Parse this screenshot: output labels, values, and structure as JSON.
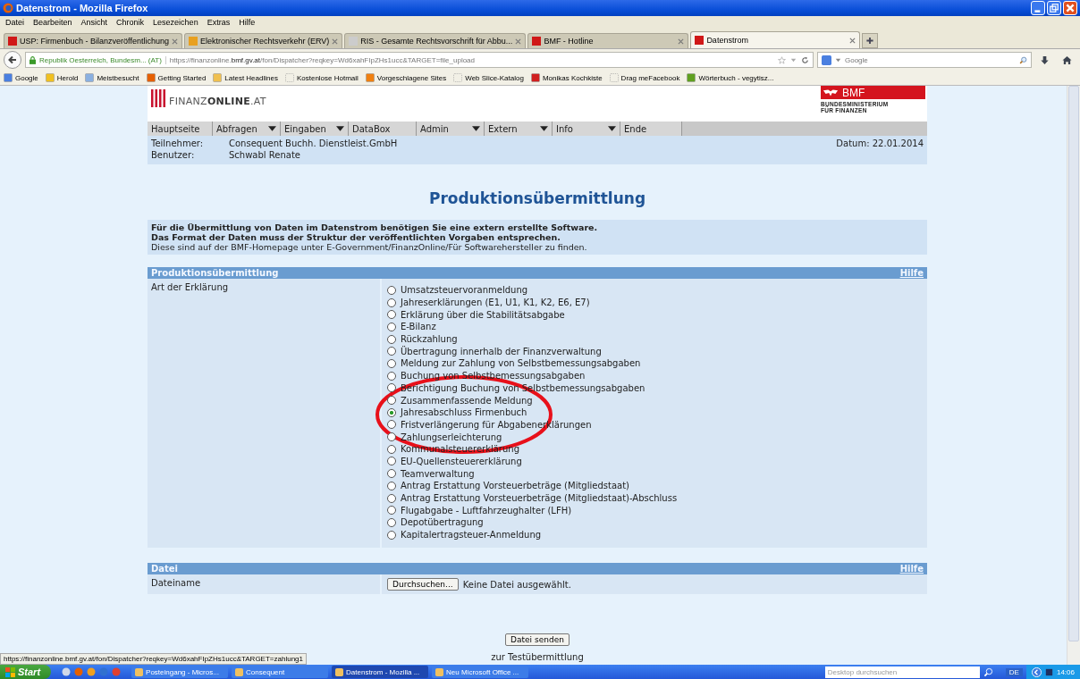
{
  "window": {
    "title": "Datenstrom - Mozilla Firefox"
  },
  "menu": [
    "Datei",
    "Bearbeiten",
    "Ansicht",
    "Chronik",
    "Lesezeichen",
    "Extras",
    "Hilfe"
  ],
  "tabs": [
    {
      "label": "USP: Firmenbuch - Bilanzveröffentlichung",
      "selected": false
    },
    {
      "label": "Elektronischer Rechtsverkehr (ERV)",
      "selected": false
    },
    {
      "label": "RIS - Gesamte Rechtsvorschrift für Abbu...",
      "selected": false
    },
    {
      "label": "BMF - Hotline",
      "selected": false
    },
    {
      "label": "Datenstrom",
      "selected": true
    }
  ],
  "address": {
    "identity": "Republik Oesterreich, Bundesm... (AT)",
    "url": "https://finanzonline.**bmf.gv.at**/fon/Dispatcher?reqkey=Wd6xahFIpZHs1ucc&TARGET=file_upload"
  },
  "search": {
    "placeholder": "Google"
  },
  "bookmarks": [
    "Google",
    "Herold",
    "Meistbesucht",
    "Getting Started",
    "Latest Headlines",
    "Kostenlose Hotmail",
    "Vorgeschlagene Sites",
    "Web Slice-Katalog",
    "Monikas Kochkiste",
    "Drag meFacebook",
    "Wörterbuch - vegytisz..."
  ],
  "page": {
    "logo": "FINANZ**ONLINE**.AT",
    "ministry": {
      "name": "BMF",
      "line1": "BUNDESMINISTERIUM",
      "line2": "FÜR FINANZEN"
    },
    "nav": [
      {
        "label": "Hauptseite",
        "dropdown": false
      },
      {
        "label": "Abfragen",
        "dropdown": true
      },
      {
        "label": "Eingaben",
        "dropdown": true
      },
      {
        "label": "DataBox",
        "dropdown": false
      },
      {
        "label": "Admin",
        "dropdown": true
      },
      {
        "label": "Extern",
        "dropdown": true
      },
      {
        "label": "Info",
        "dropdown": true
      },
      {
        "label": "Ende",
        "dropdown": false
      }
    ],
    "info": [
      {
        "label": "Teilnehmer:",
        "value": "Consequent Buchh. Dienstleist.GmbH"
      },
      {
        "label": "Benutzer:",
        "value": "Schwabl Renate"
      }
    ],
    "date": "Datum: 22.01.2014",
    "heading": "Produktionsübermittlung",
    "intro_bold": [
      "Für die Übermittlung von Daten im Datenstrom benötigen Sie eine extern erstellte Software.",
      "Das Format der Daten muss der Struktur der veröffentlichten Vorgaben entsprechen."
    ],
    "intro": "Diese sind auf der BMF-Homepage unter E-Government/FinanzOnline/Für Softwarehersteller zu finden.",
    "section": {
      "title": "Produktionsübermittlung",
      "help": "Hilfe",
      "label": "Art der Erklärung",
      "options": [
        {
          "label": "Umsatzsteuervoranmeldung",
          "selected": false
        },
        {
          "label": "Jahreserklärungen (E1, U1, K1, K2, E6, E7)",
          "selected": false
        },
        {
          "label": "Erklärung über die Stabilitätsabgabe",
          "selected": false
        },
        {
          "label": "E-Bilanz",
          "selected": false
        },
        {
          "label": "Rückzahlung",
          "selected": false
        },
        {
          "label": "Übertragung innerhalb der Finanzverwaltung",
          "selected": false
        },
        {
          "label": "Meldung zur Zahlung von Selbstbemessungsabgaben",
          "selected": false
        },
        {
          "label": "Buchung von Selbstbemessungsabgaben",
          "selected": false
        },
        {
          "label": "Berichtigung Buchung von Selbstbemessungsabgaben",
          "selected": false
        },
        {
          "label": "Zusammenfassende Meldung",
          "selected": false
        },
        {
          "label": "Jahresabschluss Firmenbuch",
          "selected": true
        },
        {
          "label": "Fristverlängerung für Abgabenerklärungen",
          "selected": false
        },
        {
          "label": "Zahlungserleichterung",
          "selected": false
        },
        {
          "label": "Kommunalsteuererklärung",
          "selected": false
        },
        {
          "label": "EU-Quellensteuererklärung",
          "selected": false
        },
        {
          "label": "Teamverwaltung",
          "selected": false
        },
        {
          "label": "Antrag Erstattung Vorsteuerbeträge (Mitgliedstaat)",
          "selected": false
        },
        {
          "label": "Antrag Erstattung Vorsteuerbeträge (Mitgliedstaat)-Abschluss",
          "selected": false
        },
        {
          "label": "Flugabgabe - Luftfahrzeughalter (LFH)",
          "selected": false
        },
        {
          "label": "Depotübertragung",
          "selected": false
        },
        {
          "label": "Kapitalertragsteuer-Anmeldung",
          "selected": false
        }
      ]
    },
    "file_section": {
      "title": "Datei",
      "help": "Hilfe",
      "label": "Dateiname",
      "button": "Durchsuchen...",
      "status": "Keine Datei ausgewählt."
    },
    "submit": "Datei senden",
    "test_link": "zur Testübermittlung"
  },
  "status_url": "https://finanzonline.bmf.gv.at/fon/Dispatcher?reqkey=Wd6xahFIpZHs1ucc&TARGET=zahlung1",
  "taskbar": {
    "start": "Start",
    "items": [
      {
        "label": "Posteingang - Micros...",
        "selected": false
      },
      {
        "label": "Consequent",
        "selected": false
      },
      {
        "label": "Datenstrom - Mozilla ...",
        "selected": true
      },
      {
        "label": "Neu Microsoft Office ...",
        "selected": false
      }
    ],
    "search": "Desktop durchsuchen",
    "lang": "DE",
    "clock": "14:06"
  }
}
